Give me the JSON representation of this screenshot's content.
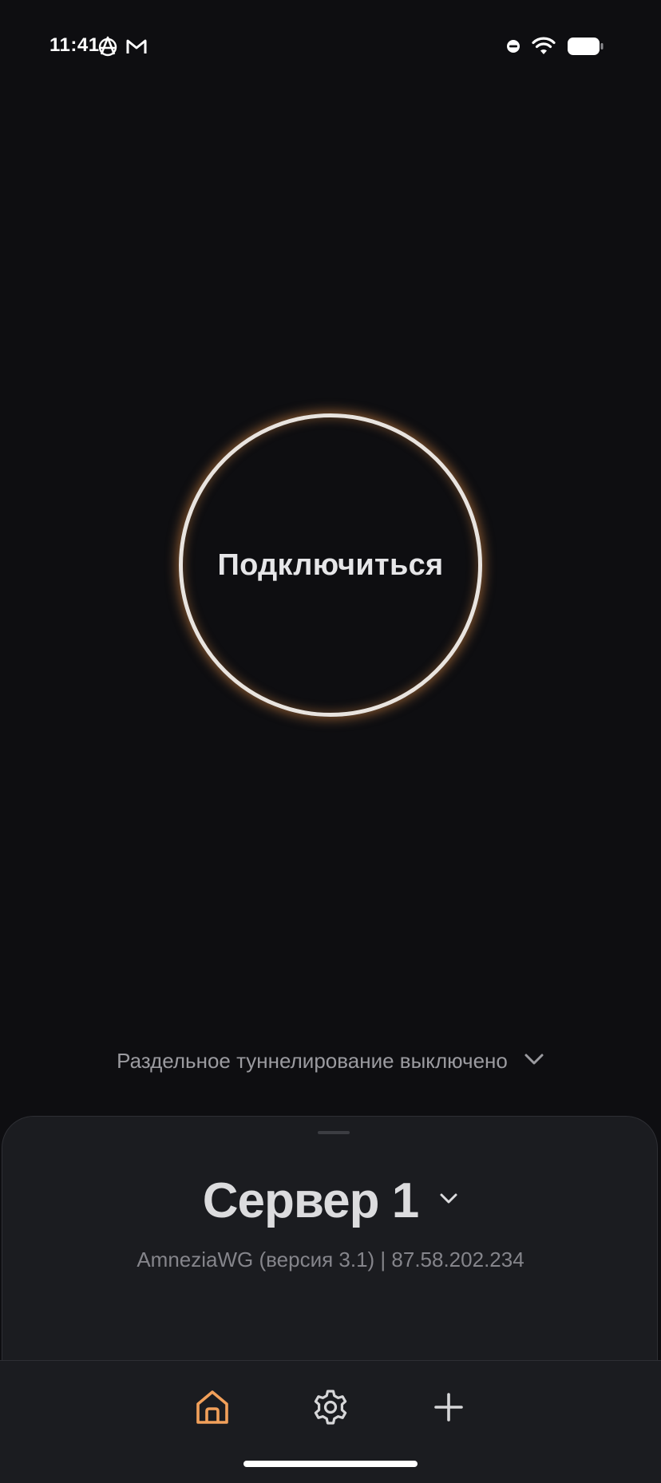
{
  "status_bar": {
    "time": "11:41",
    "left_icons": [
      "anarchy-icon",
      "gmail-icon"
    ],
    "right_icons": [
      "do-not-disturb-icon",
      "wifi-icon",
      "battery-icon"
    ]
  },
  "connect": {
    "label": "Подключиться",
    "ring_color": "#e9e4df",
    "glow_color": "#e08c46"
  },
  "split_tunneling": {
    "label": "Раздельное туннелирование выключено",
    "icon": "chevron-down-icon"
  },
  "server": {
    "name": "Сервер 1",
    "info": "AmneziaWG (версия 3.1) | 87.58.202.234",
    "icon": "chevron-down-icon"
  },
  "tab_bar": {
    "tabs": [
      {
        "icon": "home-icon",
        "active": true
      },
      {
        "icon": "gear-icon",
        "active": false
      },
      {
        "icon": "plus-icon",
        "active": false
      }
    ],
    "active_color": "#f2a05a",
    "inactive_color": "#d6d6d8"
  }
}
